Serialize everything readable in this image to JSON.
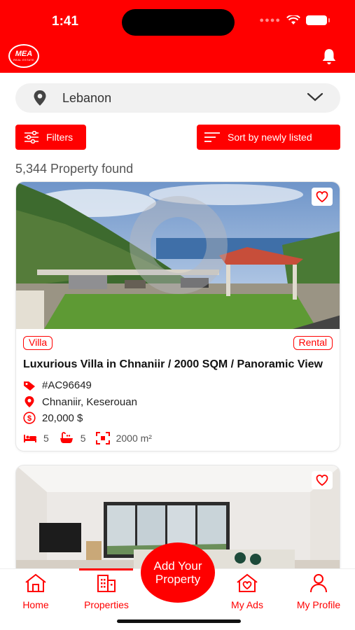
{
  "status_bar": {
    "time": "1:41"
  },
  "header": {
    "logo_text": "MEA",
    "logo_subtext": "REAL ESTATE",
    "bell_icon": "bell-icon",
    "color": "#ff0000"
  },
  "location": {
    "label": "Lebanon",
    "icon": "map-pin-icon",
    "chevron": "chevron-down-icon"
  },
  "toolbar": {
    "filters_label": "Filters",
    "sort_label": "Sort by newly listed"
  },
  "results": {
    "count_text": "5,344 Property found"
  },
  "listings": [
    {
      "type": "Villa",
      "deal": "Rental",
      "title": "Luxurious Villa in Chnaniir / 2000 SQM / Panoramic View",
      "ref": "#AC96649",
      "location": "Chnaniir, Keserouan",
      "price": "20,000 $",
      "bedrooms": "5",
      "bathrooms": "5",
      "area": "2000 m²",
      "favorited": false
    },
    {
      "favorited": false
    }
  ],
  "bottom_nav": {
    "items": [
      {
        "label": "Home",
        "icon": "home-icon"
      },
      {
        "label": "Properties",
        "icon": "buildings-icon",
        "active": true
      },
      {
        "label": "My Ads",
        "icon": "heart-house-icon"
      },
      {
        "label": "My Profile",
        "icon": "user-icon"
      }
    ],
    "fab_line1": "Add Your",
    "fab_line2": "Property"
  }
}
